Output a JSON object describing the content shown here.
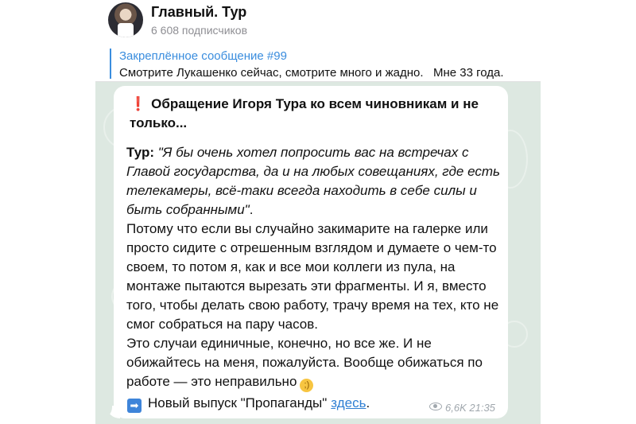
{
  "channel": {
    "title": "Главный. Тур",
    "subscribers": "6 608 подписчиков"
  },
  "pinned": {
    "title": "Закреплённое сообщение #99",
    "text": "Смотрите Лукашенко сейчас, смотрите много и жадно.   Мне 33 года."
  },
  "message": {
    "title_icon": "exclamation-icon",
    "title": "Обращение Игоря Тура ко всем чиновникам и не только...",
    "quote_author": "Тур:",
    "quote_text": "\"Я бы очень хотел попросить вас на встречах с Главой государства, да и на любых совещаниях, где есть телекамеры, всё-таки всегда находить в себе силы и быть собранными\"",
    "quote_end": ".",
    "paragraph1": "Потому что если вы случайно закимарите на галерке или просто сидите с отрешенным взглядом и думаете о чем-то своем, то потом я, как и все мои коллеги из пула, на монтаже пытаются вырезать эти фрагменты. И я, вместо того, чтобы делать свою работу, трачу время на тех, кто не смог собраться на пару часов.",
    "paragraph2": "Это случаи единичные, конечно, но все же. И не обижайтесь на меня, пожалуйста. Вообще обижаться по работе — это неправильно",
    "emoji": "wink-emoji-icon",
    "footer_icon": "arrow-right-icon",
    "footer_text": "Новый выпуск \"Пропаганды\"",
    "footer_link": "здесь",
    "footer_end": ".",
    "views": "6,6K",
    "time": "21:35"
  },
  "colors": {
    "accent": "#3a8dde",
    "link": "#2f7fd3",
    "chat_background": "#dde8e1",
    "alert": "#e0212f"
  }
}
